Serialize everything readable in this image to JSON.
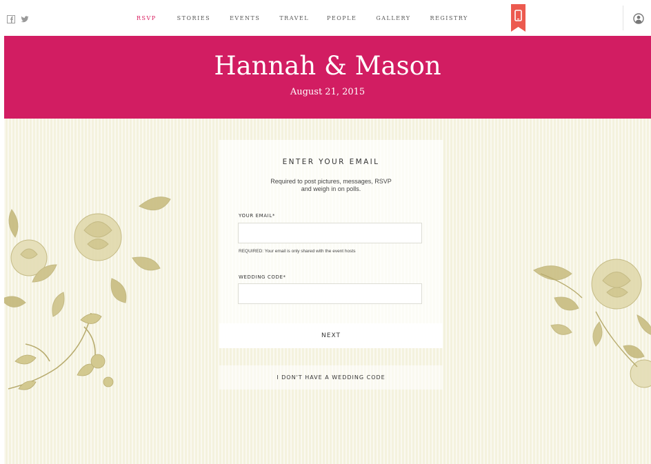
{
  "social": {
    "facebook_icon": "facebook-icon",
    "twitter_icon": "twitter-icon"
  },
  "nav": {
    "items": [
      {
        "label": "RSVP",
        "active": true
      },
      {
        "label": "STORIES"
      },
      {
        "label": "EVENTS"
      },
      {
        "label": "TRAVEL"
      },
      {
        "label": "PEOPLE"
      },
      {
        "label": "GALLERY"
      },
      {
        "label": "REGISTRY"
      }
    ],
    "mobile_icon": "mobile-phone-icon",
    "user_icon": "user-account-icon"
  },
  "header": {
    "title": "Hannah & Mason",
    "date": "August 21, 2015"
  },
  "form": {
    "heading": "ENTER YOUR EMAIL",
    "subtext_line1": "Required to post pictures, messages, RSVP",
    "subtext_line2": "and weigh in on polls.",
    "email_label": "YOUR EMAIL*",
    "email_value": "",
    "email_hint": "REQUIRED: Your email is only shared with the event hosts",
    "code_label": "WEDDING CODE*",
    "code_value": "",
    "next_label": "NEXT",
    "no_code_label": "I DON'T HAVE A WEDDING CODE"
  },
  "colors": {
    "brand": "#d21d62",
    "active_nav": "#d81d5f",
    "background": "#f4f2de",
    "mobile_badge": "#ec5a4f"
  }
}
